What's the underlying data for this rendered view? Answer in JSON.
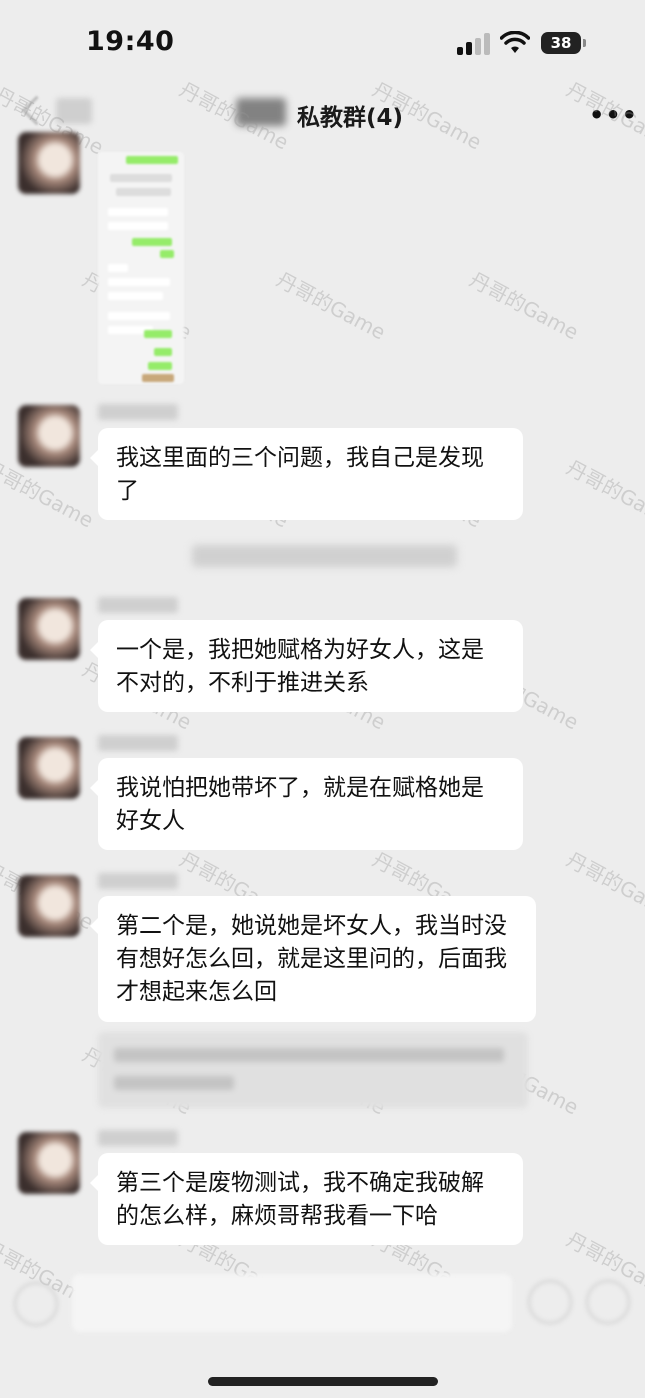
{
  "status_bar": {
    "time": "19:40",
    "battery": "38"
  },
  "nav": {
    "title": "私教群(4)",
    "more_icon": "more-icon"
  },
  "messages": [
    {
      "text": "我这里面的三个问题，我自己是发现了"
    },
    {
      "text": "一个是，我把她赋格为好女人，这是不对的，不利于推进关系"
    },
    {
      "text": "我说怕把她带坏了，就是在赋格她是好女人"
    },
    {
      "text": "第二个是，她说她是坏女人，我当时没有想好怎么回，就是这里问的，后面我才想起来怎么回"
    },
    {
      "text": "第三个是废物测试，我不确定我破解的怎么样，麻烦哥帮我看一下哈"
    }
  ],
  "watermark": "丹哥的Game",
  "colors": {
    "background": "#ededed",
    "bubble": "#ffffff",
    "text": "#111111"
  }
}
